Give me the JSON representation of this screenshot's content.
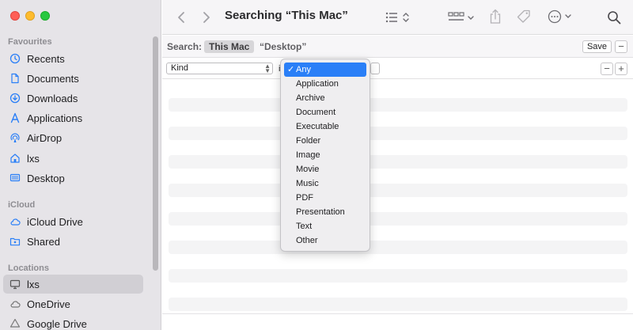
{
  "window": {
    "title": "Searching “This Mac”"
  },
  "sidebar": {
    "sections": [
      {
        "label": "Favourites"
      },
      {
        "label": "iCloud"
      },
      {
        "label": "Locations"
      }
    ],
    "favourites": [
      {
        "label": "Recents",
        "icon": "clock-icon"
      },
      {
        "label": "Documents",
        "icon": "document-icon"
      },
      {
        "label": "Downloads",
        "icon": "download-icon"
      },
      {
        "label": "Applications",
        "icon": "applications-icon"
      },
      {
        "label": "AirDrop",
        "icon": "airdrop-icon"
      },
      {
        "label": "lxs",
        "icon": "home-icon"
      },
      {
        "label": "Desktop",
        "icon": "desktop-icon"
      }
    ],
    "icloud": [
      {
        "label": "iCloud Drive",
        "icon": "cloud-icon"
      },
      {
        "label": "Shared",
        "icon": "shared-folder-icon"
      }
    ],
    "locations": [
      {
        "label": "lxs",
        "icon": "computer-icon",
        "selected": true
      },
      {
        "label": "OneDrive",
        "icon": "cloud-icon"
      },
      {
        "label": "Google Drive",
        "icon": "drive-icon"
      }
    ]
  },
  "searchbar": {
    "label": "Search:",
    "scope_selected": "This Mac",
    "scope_other": "“Desktop”",
    "save_label": "Save",
    "minus": "−"
  },
  "criteria": {
    "attribute": "Kind",
    "operator_partial": "i",
    "minus": "−",
    "plus": "+"
  },
  "dropdown": {
    "check": "✓",
    "selected": "Any",
    "options": [
      "Any",
      "Application",
      "Archive",
      "Document",
      "Executable",
      "Folder",
      "Image",
      "Movie",
      "Music",
      "PDF",
      "Presentation",
      "Text",
      "Other"
    ]
  },
  "colors": {
    "accent": "#2a7ff7",
    "sidebar_bg": "#e6e4e8",
    "close": "#fe5f57",
    "minimize": "#febc2e",
    "zoom": "#28c840"
  }
}
